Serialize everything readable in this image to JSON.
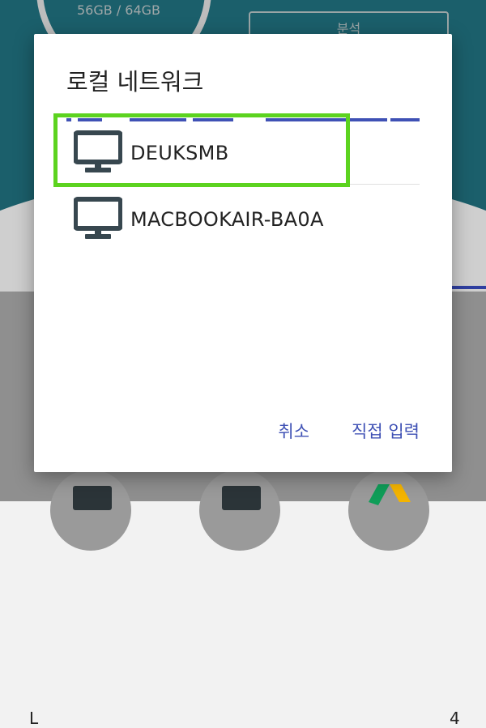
{
  "background": {
    "storage_text": "56GB / 64GB",
    "analyze_label": "분석",
    "left_letter": "L",
    "right_letter": "4"
  },
  "dialog": {
    "title": "로컬 네트워크",
    "servers": [
      {
        "label": "DEUKSMB",
        "icon": "computer-monitor-icon"
      },
      {
        "label": "MACBOOKAIR-BA0A",
        "icon": "computer-monitor-icon"
      }
    ],
    "cancel_label": "취소",
    "manual_label": "직접 입력"
  },
  "colors": {
    "accent": "#3f51b5",
    "highlight": "#5cd31f",
    "icon": "#37474f"
  }
}
